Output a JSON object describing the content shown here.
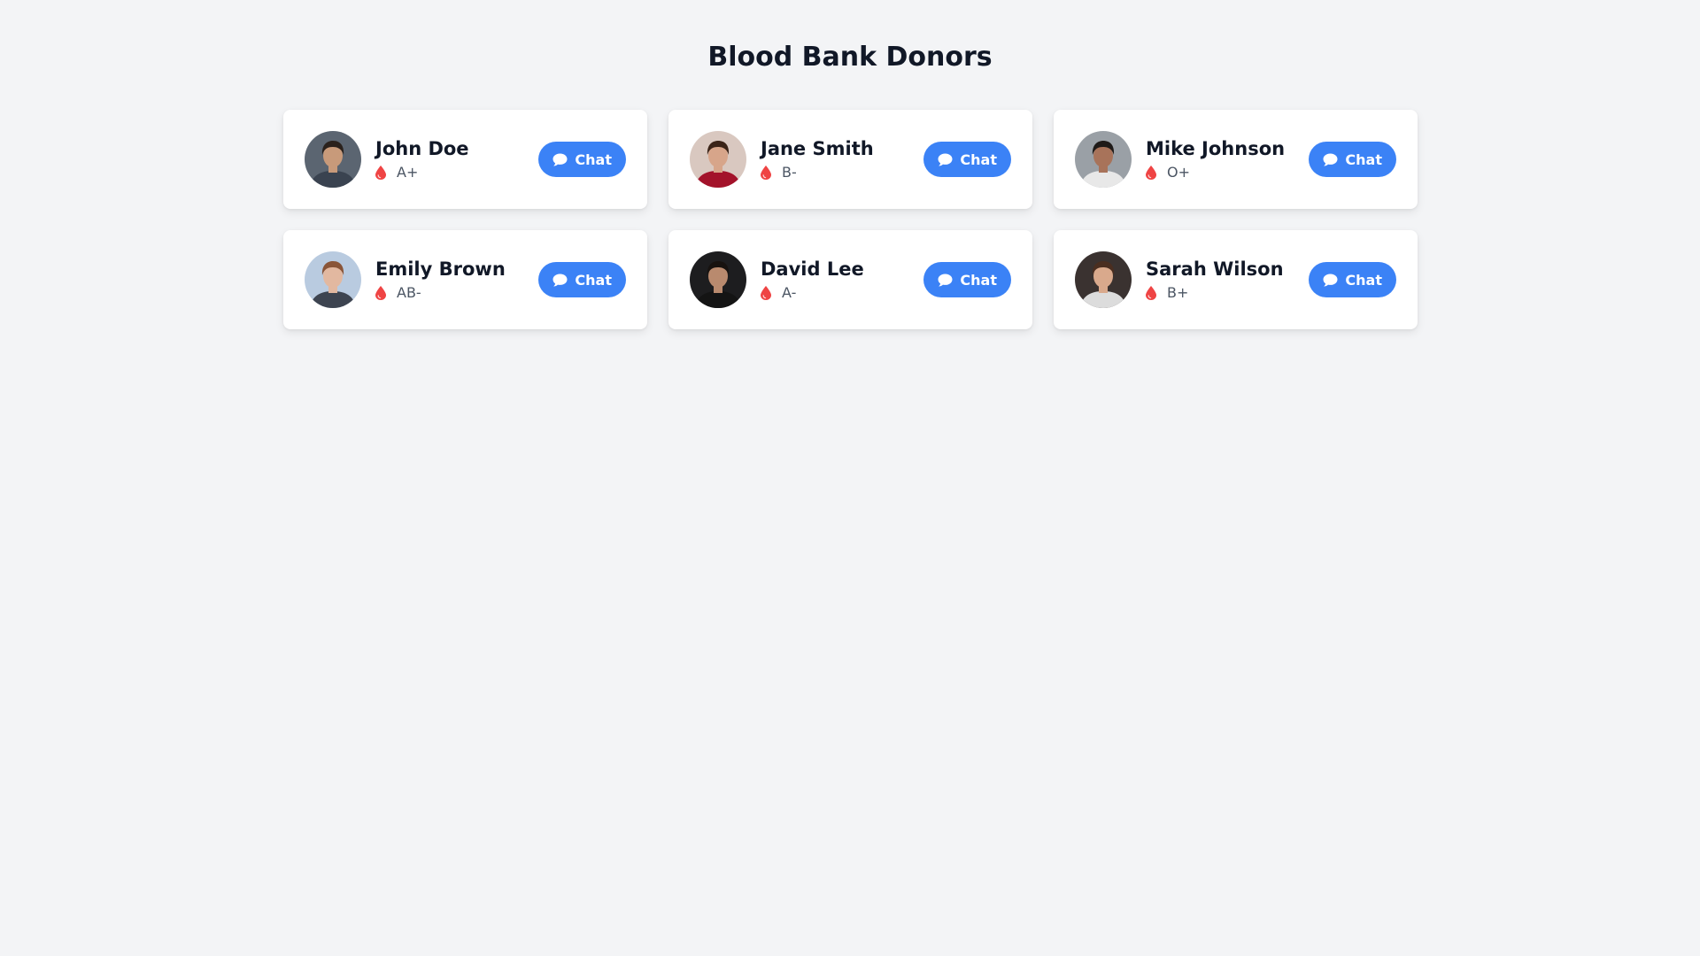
{
  "page": {
    "title": "Blood Bank Donors"
  },
  "colors": {
    "background": "#f3f4f6",
    "card": "#ffffff",
    "accent": "#3b82f6",
    "blood": "#ef4444",
    "name_text": "#111827",
    "type_text": "#4b5563"
  },
  "icons": {
    "blood": "blood-drop-icon",
    "chat": "chat-bubble-icon"
  },
  "donors": [
    {
      "name": "John Doe",
      "blood_type": "A+",
      "chat_label": "Chat",
      "avatar": {
        "bg": "#5b6571",
        "skin": "#c89a7a",
        "hair": "#2a211c",
        "shirt": "#3a4350"
      }
    },
    {
      "name": "Jane Smith",
      "blood_type": "B-",
      "chat_label": "Chat",
      "avatar": {
        "bg": "#d9c8c0",
        "skin": "#d7a58a",
        "hair": "#3b2418",
        "shirt": "#a3122a"
      }
    },
    {
      "name": "Mike Johnson",
      "blood_type": "O+",
      "chat_label": "Chat",
      "avatar": {
        "bg": "#9aa0a6",
        "skin": "#a8735a",
        "hair": "#1e1a18",
        "shirt": "#e8e8e8"
      }
    },
    {
      "name": "Emily Brown",
      "blood_type": "AB-",
      "chat_label": "Chat",
      "avatar": {
        "bg": "#b9cbe0",
        "skin": "#e2b8a0",
        "hair": "#8a5538",
        "shirt": "#3d4450"
      }
    },
    {
      "name": "David Lee",
      "blood_type": "A-",
      "chat_label": "Chat",
      "avatar": {
        "bg": "#1d1d1f",
        "skin": "#b98a6e",
        "hair": "#17120f",
        "shirt": "#141414"
      }
    },
    {
      "name": "Sarah Wilson",
      "blood_type": "B+",
      "chat_label": "Chat",
      "avatar": {
        "bg": "#3a3230",
        "skin": "#d9a98c",
        "hair": "#4a2e20",
        "shirt": "#dcdcdc"
      }
    }
  ]
}
